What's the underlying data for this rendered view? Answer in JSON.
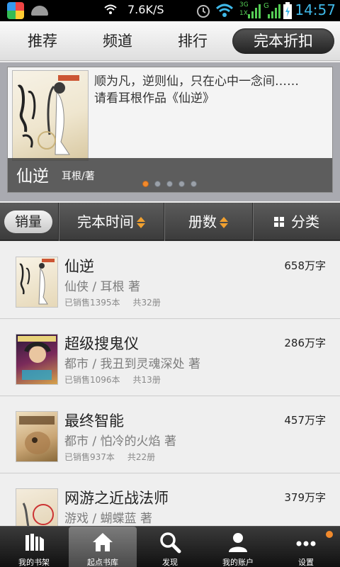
{
  "status_bar": {
    "net_speed": "7.6K/S",
    "time": "14:57",
    "signal_labels": [
      "3G",
      "1X",
      "G"
    ]
  },
  "tabs": [
    "推荐",
    "频道",
    "排行",
    "完本折扣"
  ],
  "active_tab": 3,
  "banner": {
    "description": "顺为凡，逆则仙，只在心中一念间……　　请看耳根作品《仙逆》",
    "title": "仙逆",
    "author": "耳根/著",
    "slide_count": 5,
    "active_slide": 0
  },
  "sort_bar": {
    "sales": "销量",
    "finish_time": "完本时间",
    "volumes": "册数",
    "category": "分类"
  },
  "books": [
    {
      "title": "仙逆",
      "words": "658万字",
      "subtitle": "仙侠 / 耳根 著",
      "sold": "已销售1395本",
      "volumes": "共32册",
      "cover_color": "#efe6cf"
    },
    {
      "title": "超级搜鬼仪",
      "words": "286万字",
      "subtitle": "都市 / 我丑到灵魂深处 著",
      "sold": "已销售1096本",
      "volumes": "共13册",
      "cover_color": "#5a2a6a"
    },
    {
      "title": "最终智能",
      "words": "457万字",
      "subtitle": "都市 / 怕冷的火焰 著",
      "sold": "已销售937本",
      "volumes": "共22册",
      "cover_color": "#c9a574"
    },
    {
      "title": "网游之近战法师",
      "words": "379万字",
      "subtitle": "游戏 / 蝴蝶蓝 著",
      "sold": "",
      "volumes": "",
      "cover_color": "#e8dcc8"
    }
  ],
  "bottom_nav": [
    {
      "label": "我的书架",
      "icon": "bookshelf-icon"
    },
    {
      "label": "起点书库",
      "icon": "home-icon"
    },
    {
      "label": "发现",
      "icon": "search-icon"
    },
    {
      "label": "我的账户",
      "icon": "user-icon"
    },
    {
      "label": "设置",
      "icon": "more-icon"
    }
  ],
  "active_nav": 1,
  "colors": {
    "accent_orange": "#f28a2c",
    "status_time_blue": "#3fb8e8",
    "bar_dark": "#3c3c3c"
  }
}
